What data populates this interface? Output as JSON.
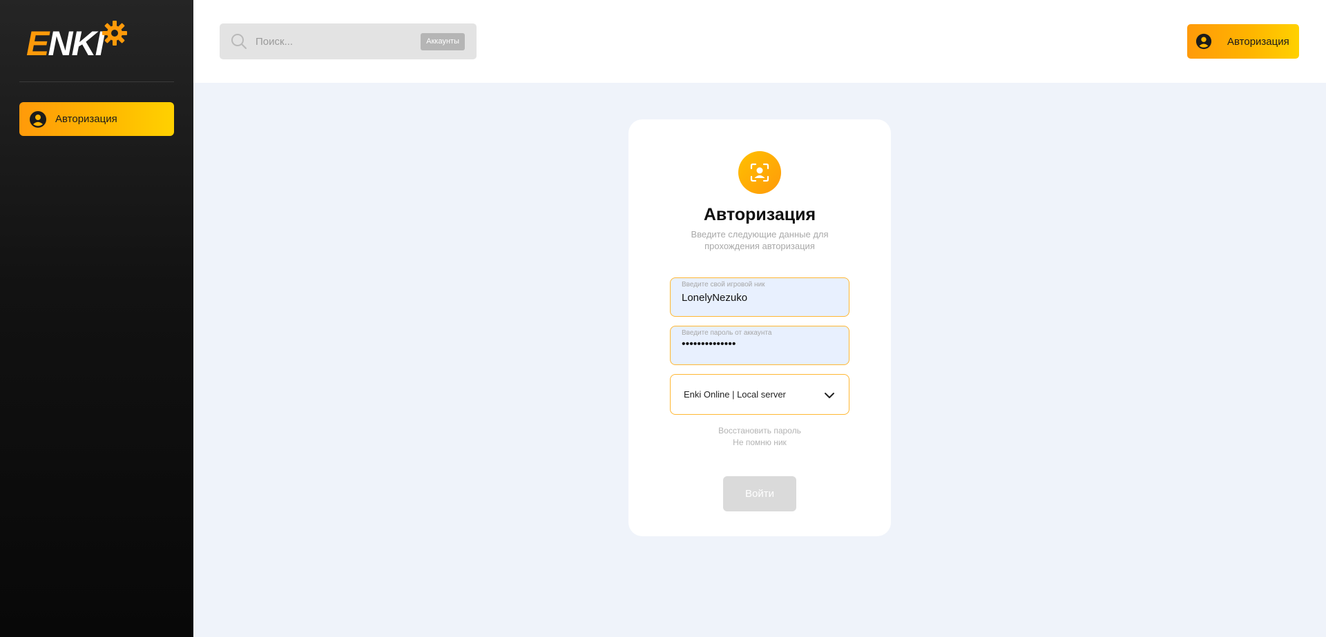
{
  "sidebar": {
    "logo_text": "ENKI",
    "items": [
      {
        "label": "Авторизация",
        "icon": "user-circle-icon",
        "active": true
      }
    ]
  },
  "header": {
    "search": {
      "placeholder": "Поиск...",
      "scope_label": "Аккаунты"
    },
    "auth_button_label": "Авторизация"
  },
  "auth_card": {
    "icon": "face-id-icon",
    "title": "Авторизация",
    "subtitle": "Введите следующие данные для прохождения авторизация",
    "login_field": {
      "label": "Введите свой игровой ник",
      "value": "LonelyNezuko"
    },
    "password_field": {
      "label": "Введите пароль от аккаунта",
      "value": "••••••••••••••"
    },
    "server_select": {
      "value": "Enki Online | Local server"
    },
    "restore_password_link": "Восстановить пароль",
    "forgot_nick_link": "Не помню ник",
    "submit_label": "Войти"
  },
  "colors": {
    "accent_start": "#ff9a0a",
    "accent_end": "#ffd100",
    "field_border": "#ffb733",
    "page_background": "#eff3fa",
    "sidebar_background": "#121212"
  }
}
